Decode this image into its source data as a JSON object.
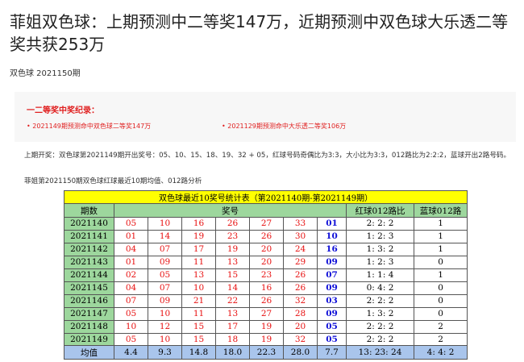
{
  "article": {
    "title": "菲姐双色球：上期预测中二等奖147万，近期预测中双色球大乐透二等奖共获253万",
    "subtitle": "双色球 2021150期"
  },
  "record": {
    "title": "一二等奖中奖纪录：",
    "items": [
      "• 2021149期预测命中双色球二等奖147万",
      "• 2021129期预测命中大乐透二等奖106万"
    ]
  },
  "paragraphs": {
    "last_draw": "上期开奖：双色球第2021149期开出奖号：05、10、15、18、19、32 + 05，红球号码奇偶比为3:3，大小比为3:3，012路比为2:2:2，蓝球开出2路号码。",
    "intro": "菲姐第2021150期双色球红球最近10期均值、012路分析"
  },
  "table": {
    "caption": "双色球最近10奖号统计表（第2021140期-第2021149期）",
    "headers": [
      "期数",
      "奖号",
      "红球012路比",
      "蓝球012路"
    ],
    "rows": [
      {
        "period": "2021140",
        "reds": [
          "05",
          "10",
          "16",
          "26",
          "27",
          "33"
        ],
        "blue": "01",
        "ratio": "2: 2: 2",
        "blue_route": "1"
      },
      {
        "period": "2021141",
        "reds": [
          "01",
          "14",
          "19",
          "23",
          "26",
          "30"
        ],
        "blue": "10",
        "ratio": "1: 2: 3",
        "blue_route": "1"
      },
      {
        "period": "2021142",
        "reds": [
          "04",
          "07",
          "17",
          "19",
          "20",
          "24"
        ],
        "blue": "16",
        "ratio": "1: 3: 2",
        "blue_route": "1"
      },
      {
        "period": "2021143",
        "reds": [
          "01",
          "09",
          "11",
          "13",
          "20",
          "29"
        ],
        "blue": "09",
        "ratio": "1: 2: 3",
        "blue_route": "0"
      },
      {
        "period": "2021144",
        "reds": [
          "02",
          "05",
          "13",
          "15",
          "23",
          "26"
        ],
        "blue": "07",
        "ratio": "1: 1: 4",
        "blue_route": "1"
      },
      {
        "period": "2021145",
        "reds": [
          "04",
          "07",
          "10",
          "14",
          "16",
          "26"
        ],
        "blue": "09",
        "ratio": "0: 4: 2",
        "blue_route": "0"
      },
      {
        "period": "2021146",
        "reds": [
          "07",
          "09",
          "21",
          "22",
          "26",
          "32"
        ],
        "blue": "03",
        "ratio": "2: 2: 2",
        "blue_route": "0"
      },
      {
        "period": "2021147",
        "reds": [
          "05",
          "10",
          "11",
          "13",
          "27",
          "28"
        ],
        "blue": "09",
        "ratio": "1: 3: 2",
        "blue_route": "0"
      },
      {
        "period": "2021148",
        "reds": [
          "10",
          "12",
          "15",
          "17",
          "19",
          "20"
        ],
        "blue": "05",
        "ratio": "2: 2: 2",
        "blue_route": "2"
      },
      {
        "period": "2021149",
        "reds": [
          "05",
          "10",
          "15",
          "18",
          "19",
          "32"
        ],
        "blue": "05",
        "ratio": "2: 2: 2",
        "blue_route": "2"
      }
    ],
    "average": {
      "label": "均值",
      "reds": [
        "4.4",
        "9.3",
        "14.8",
        "18.0",
        "22.3",
        "28.0"
      ],
      "blue": "7.7",
      "ratio": "13: 23: 24",
      "blue_route": "4: 4: 2"
    }
  },
  "colors": {
    "red_ball": "#e81010",
    "blue_ball": "#1010d8",
    "header_bg": "#9dd79d",
    "caption_bg": "#ffff00",
    "average_bg": "#a9c5ec",
    "record_text": "#e02020"
  }
}
